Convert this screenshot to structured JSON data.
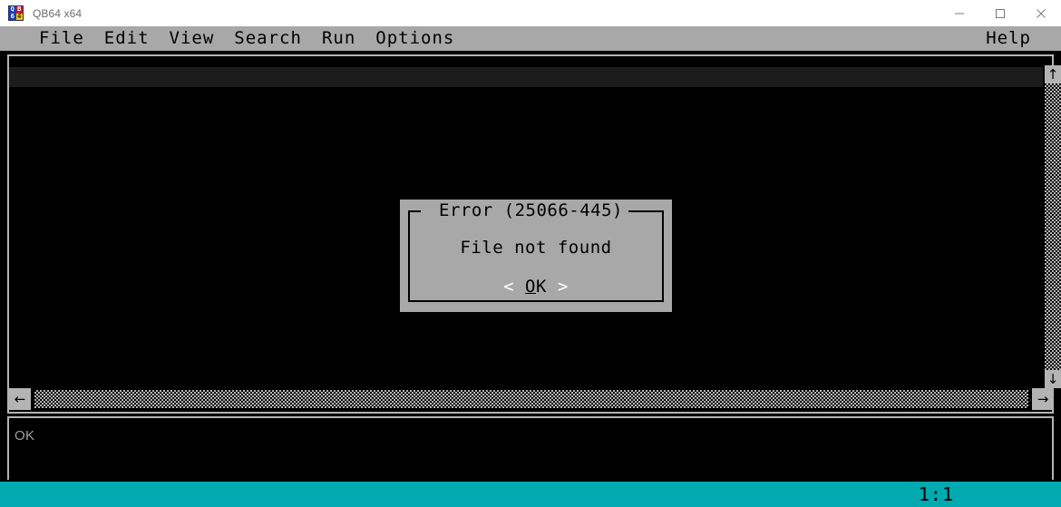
{
  "window": {
    "title": "QB64 x64",
    "icon": "qb64-app-icon",
    "icon_quadrants": [
      "Q",
      "B",
      "6",
      "4"
    ],
    "controls": [
      {
        "name": "minimize-button",
        "glyph": "minimize-icon"
      },
      {
        "name": "maximize-button",
        "glyph": "maximize-icon"
      },
      {
        "name": "close-button",
        "glyph": "close-icon"
      }
    ]
  },
  "menubar": {
    "items": [
      {
        "label": "File"
      },
      {
        "label": "Edit"
      },
      {
        "label": "View"
      },
      {
        "label": "Search"
      },
      {
        "label": "Run"
      },
      {
        "label": "Options"
      }
    ],
    "help": {
      "label": "Help"
    }
  },
  "editor": {
    "content": "",
    "vscroll": {
      "up_arrow": "↑",
      "down_arrow": "↓"
    },
    "hscroll": {
      "left_arrow": "←",
      "right_arrow": "→"
    }
  },
  "output": {
    "text": "OK"
  },
  "statusbar": {
    "position": "1:1"
  },
  "dialog": {
    "title": "Error (25066-445)",
    "message": "File not found",
    "button": {
      "left_bracket": "<",
      "label": "OK",
      "accel": "O",
      "rest": "K",
      "right_bracket": ">"
    }
  },
  "colors": {
    "menubar_gray": "#a8a8a8",
    "dialog_gray": "#a8a8a8",
    "editor_black": "#000000",
    "frame_gray": "#b4b4b4",
    "statusbar_teal": "#00aab0",
    "titlebar_white": "#ffffff",
    "output_text_gray": "#a0a0a0"
  }
}
